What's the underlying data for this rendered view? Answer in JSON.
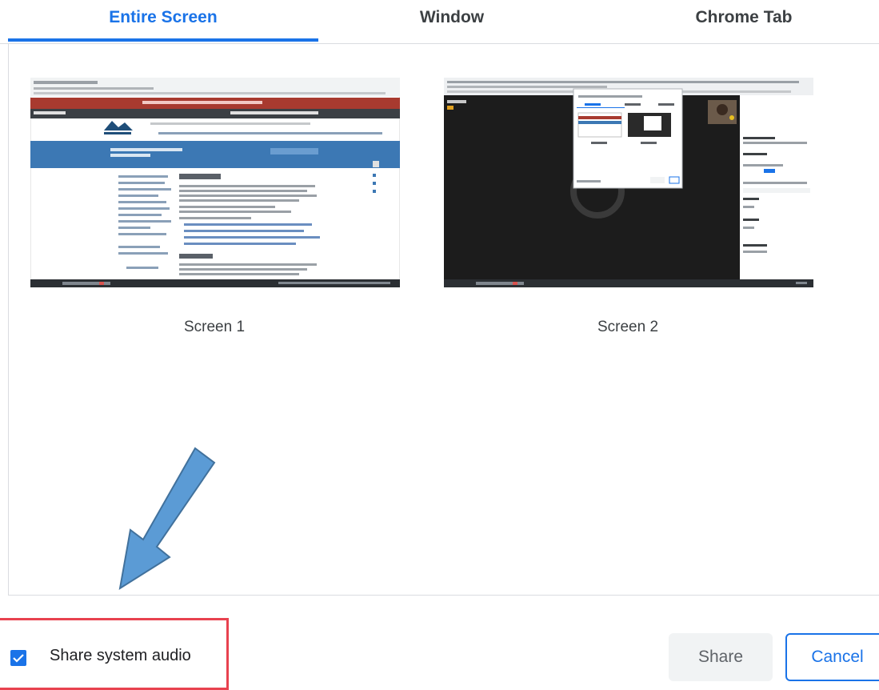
{
  "tabs": [
    {
      "label": "Entire Screen",
      "active": true
    },
    {
      "label": "Window",
      "active": false
    },
    {
      "label": "Chrome Tab",
      "active": false
    }
  ],
  "screens": [
    {
      "label": "Screen 1"
    },
    {
      "label": "Screen 2"
    }
  ],
  "footer": {
    "audio_checkbox_checked": true,
    "audio_label": "Share system audio",
    "share_label": "Share",
    "cancel_label": "Cancel"
  },
  "annotation": {
    "arrow_color": "#5b9bd5",
    "highlight_color": "#e8424f"
  },
  "colors": {
    "accent": "#1a73e8"
  }
}
